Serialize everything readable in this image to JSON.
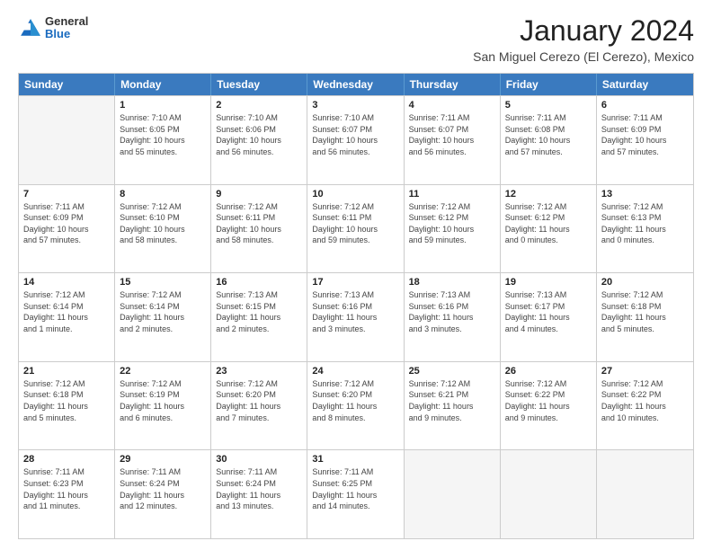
{
  "logo": {
    "general": "General",
    "blue": "Blue"
  },
  "header": {
    "title": "January 2024",
    "subtitle": "San Miguel Cerezo (El Cerezo), Mexico"
  },
  "calendar": {
    "days": [
      "Sunday",
      "Monday",
      "Tuesday",
      "Wednesday",
      "Thursday",
      "Friday",
      "Saturday"
    ],
    "rows": [
      [
        {
          "num": "",
          "empty": true,
          "lines": []
        },
        {
          "num": "1",
          "empty": false,
          "lines": [
            "Sunrise: 7:10 AM",
            "Sunset: 6:05 PM",
            "Daylight: 10 hours",
            "and 55 minutes."
          ]
        },
        {
          "num": "2",
          "empty": false,
          "lines": [
            "Sunrise: 7:10 AM",
            "Sunset: 6:06 PM",
            "Daylight: 10 hours",
            "and 56 minutes."
          ]
        },
        {
          "num": "3",
          "empty": false,
          "lines": [
            "Sunrise: 7:10 AM",
            "Sunset: 6:07 PM",
            "Daylight: 10 hours",
            "and 56 minutes."
          ]
        },
        {
          "num": "4",
          "empty": false,
          "lines": [
            "Sunrise: 7:11 AM",
            "Sunset: 6:07 PM",
            "Daylight: 10 hours",
            "and 56 minutes."
          ]
        },
        {
          "num": "5",
          "empty": false,
          "lines": [
            "Sunrise: 7:11 AM",
            "Sunset: 6:08 PM",
            "Daylight: 10 hours",
            "and 57 minutes."
          ]
        },
        {
          "num": "6",
          "empty": false,
          "lines": [
            "Sunrise: 7:11 AM",
            "Sunset: 6:09 PM",
            "Daylight: 10 hours",
            "and 57 minutes."
          ]
        }
      ],
      [
        {
          "num": "7",
          "empty": false,
          "lines": [
            "Sunrise: 7:11 AM",
            "Sunset: 6:09 PM",
            "Daylight: 10 hours",
            "and 57 minutes."
          ]
        },
        {
          "num": "8",
          "empty": false,
          "lines": [
            "Sunrise: 7:12 AM",
            "Sunset: 6:10 PM",
            "Daylight: 10 hours",
            "and 58 minutes."
          ]
        },
        {
          "num": "9",
          "empty": false,
          "lines": [
            "Sunrise: 7:12 AM",
            "Sunset: 6:11 PM",
            "Daylight: 10 hours",
            "and 58 minutes."
          ]
        },
        {
          "num": "10",
          "empty": false,
          "lines": [
            "Sunrise: 7:12 AM",
            "Sunset: 6:11 PM",
            "Daylight: 10 hours",
            "and 59 minutes."
          ]
        },
        {
          "num": "11",
          "empty": false,
          "lines": [
            "Sunrise: 7:12 AM",
            "Sunset: 6:12 PM",
            "Daylight: 10 hours",
            "and 59 minutes."
          ]
        },
        {
          "num": "12",
          "empty": false,
          "lines": [
            "Sunrise: 7:12 AM",
            "Sunset: 6:12 PM",
            "Daylight: 11 hours",
            "and 0 minutes."
          ]
        },
        {
          "num": "13",
          "empty": false,
          "lines": [
            "Sunrise: 7:12 AM",
            "Sunset: 6:13 PM",
            "Daylight: 11 hours",
            "and 0 minutes."
          ]
        }
      ],
      [
        {
          "num": "14",
          "empty": false,
          "lines": [
            "Sunrise: 7:12 AM",
            "Sunset: 6:14 PM",
            "Daylight: 11 hours",
            "and 1 minute."
          ]
        },
        {
          "num": "15",
          "empty": false,
          "lines": [
            "Sunrise: 7:12 AM",
            "Sunset: 6:14 PM",
            "Daylight: 11 hours",
            "and 2 minutes."
          ]
        },
        {
          "num": "16",
          "empty": false,
          "lines": [
            "Sunrise: 7:13 AM",
            "Sunset: 6:15 PM",
            "Daylight: 11 hours",
            "and 2 minutes."
          ]
        },
        {
          "num": "17",
          "empty": false,
          "lines": [
            "Sunrise: 7:13 AM",
            "Sunset: 6:16 PM",
            "Daylight: 11 hours",
            "and 3 minutes."
          ]
        },
        {
          "num": "18",
          "empty": false,
          "lines": [
            "Sunrise: 7:13 AM",
            "Sunset: 6:16 PM",
            "Daylight: 11 hours",
            "and 3 minutes."
          ]
        },
        {
          "num": "19",
          "empty": false,
          "lines": [
            "Sunrise: 7:13 AM",
            "Sunset: 6:17 PM",
            "Daylight: 11 hours",
            "and 4 minutes."
          ]
        },
        {
          "num": "20",
          "empty": false,
          "lines": [
            "Sunrise: 7:12 AM",
            "Sunset: 6:18 PM",
            "Daylight: 11 hours",
            "and 5 minutes."
          ]
        }
      ],
      [
        {
          "num": "21",
          "empty": false,
          "lines": [
            "Sunrise: 7:12 AM",
            "Sunset: 6:18 PM",
            "Daylight: 11 hours",
            "and 5 minutes."
          ]
        },
        {
          "num": "22",
          "empty": false,
          "lines": [
            "Sunrise: 7:12 AM",
            "Sunset: 6:19 PM",
            "Daylight: 11 hours",
            "and 6 minutes."
          ]
        },
        {
          "num": "23",
          "empty": false,
          "lines": [
            "Sunrise: 7:12 AM",
            "Sunset: 6:20 PM",
            "Daylight: 11 hours",
            "and 7 minutes."
          ]
        },
        {
          "num": "24",
          "empty": false,
          "lines": [
            "Sunrise: 7:12 AM",
            "Sunset: 6:20 PM",
            "Daylight: 11 hours",
            "and 8 minutes."
          ]
        },
        {
          "num": "25",
          "empty": false,
          "lines": [
            "Sunrise: 7:12 AM",
            "Sunset: 6:21 PM",
            "Daylight: 11 hours",
            "and 9 minutes."
          ]
        },
        {
          "num": "26",
          "empty": false,
          "lines": [
            "Sunrise: 7:12 AM",
            "Sunset: 6:22 PM",
            "Daylight: 11 hours",
            "and 9 minutes."
          ]
        },
        {
          "num": "27",
          "empty": false,
          "lines": [
            "Sunrise: 7:12 AM",
            "Sunset: 6:22 PM",
            "Daylight: 11 hours",
            "and 10 minutes."
          ]
        }
      ],
      [
        {
          "num": "28",
          "empty": false,
          "lines": [
            "Sunrise: 7:11 AM",
            "Sunset: 6:23 PM",
            "Daylight: 11 hours",
            "and 11 minutes."
          ]
        },
        {
          "num": "29",
          "empty": false,
          "lines": [
            "Sunrise: 7:11 AM",
            "Sunset: 6:24 PM",
            "Daylight: 11 hours",
            "and 12 minutes."
          ]
        },
        {
          "num": "30",
          "empty": false,
          "lines": [
            "Sunrise: 7:11 AM",
            "Sunset: 6:24 PM",
            "Daylight: 11 hours",
            "and 13 minutes."
          ]
        },
        {
          "num": "31",
          "empty": false,
          "lines": [
            "Sunrise: 7:11 AM",
            "Sunset: 6:25 PM",
            "Daylight: 11 hours",
            "and 14 minutes."
          ]
        },
        {
          "num": "",
          "empty": true,
          "lines": []
        },
        {
          "num": "",
          "empty": true,
          "lines": []
        },
        {
          "num": "",
          "empty": true,
          "lines": []
        }
      ]
    ]
  }
}
